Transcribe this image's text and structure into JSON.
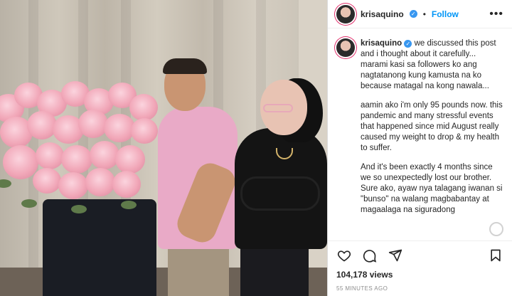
{
  "post": {
    "username": "krisaquino",
    "verified_mark": "✓",
    "separator": "•",
    "follow_label": "Follow",
    "more_label": "•••",
    "caption_username": "krisaquino",
    "caption_paragraphs": [
      "we discussed this post and i thought about it carefully... marami kasi sa followers ko ang nagtatanong kung kamusta na ko because matagal na kong nawala...",
      "aamin ako i'm only 95 pounds now. this pandemic and many stressful events that happened since mid August really caused my weight to drop & my health to suffer.",
      "And it's been exactly 4 months since we so unexpectedly lost our brother. Sure ako, ayaw nya talagang iwanan si \"bunso\" na walang magbabantay at magaalaga na siguradong"
    ],
    "views": "104,178 views",
    "time": "55 MINUTES AGO"
  },
  "icons": {
    "like": "heart-icon",
    "comment": "comment-icon",
    "share": "paper-plane-icon",
    "save": "bookmark-icon"
  },
  "colors": {
    "follow": "#0095f6",
    "verified": "#3897f0",
    "story_ring": "#e1306c"
  }
}
